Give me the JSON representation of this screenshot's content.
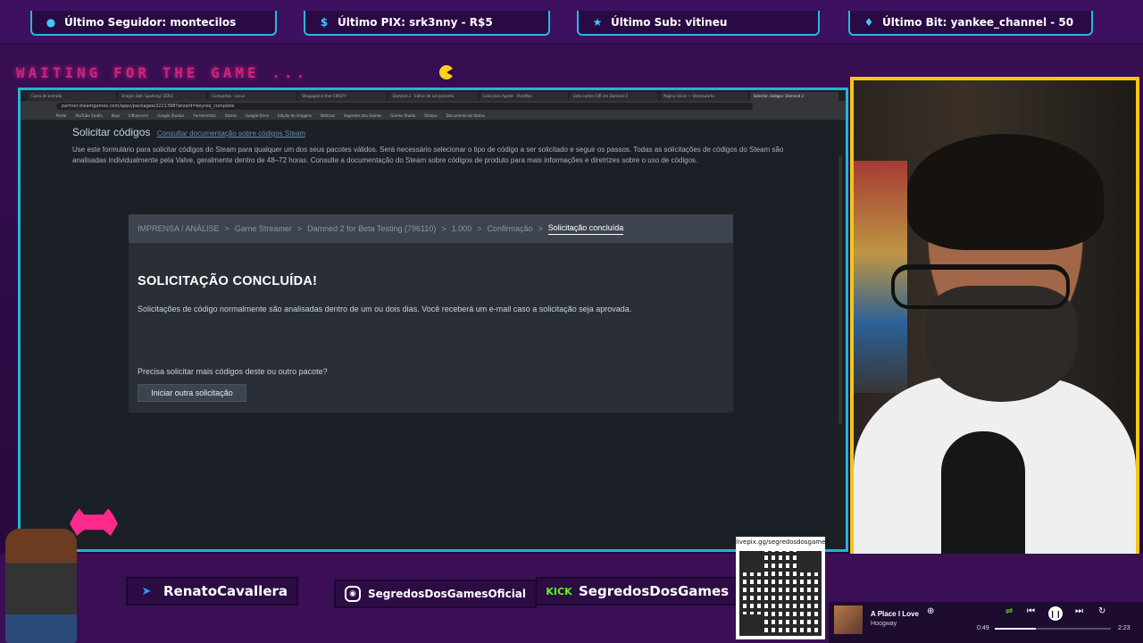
{
  "alerts": [
    {
      "icon": "user-icon",
      "label": "Último Seguidor: montecilos"
    },
    {
      "icon": "dollar-icon",
      "label": "Último PIX: srk3nny - R$5"
    },
    {
      "icon": "star-icon",
      "label": "Último Sub: vitineu"
    },
    {
      "icon": "diamond-icon",
      "label": "Último Bit: yankee_channel - 50"
    }
  ],
  "brand": {
    "waiting": "WAITING FOR THE GAME ..."
  },
  "browser": {
    "tabs": [
      "Caixa de entrada",
      "Dragon Ball: Sparking! ZERO",
      "Compartes - arcvo",
      "Shoppgame that CRAZY!",
      "Damned 2 - Editor de Lançamento",
      "Colecções Applet - PlanMax",
      "Lista contos CJR em Damned 2",
      "Página inicial — Steamworks",
      "Solicitar códigos: Damned 2"
    ],
    "url": "partner.steamgames.com/apps/packages/2221398?wizard=keyreq_complete",
    "bookmarks": [
      "Portal",
      "YouTube Studio",
      "Keys",
      "Influencers",
      "Google Studios",
      "Ferramentas",
      "Outros",
      "Google Drive",
      "Edição de imagens",
      "Notícias",
      "Segredos dos Games",
      "Games Studio",
      "Stratus",
      "Documento de Status"
    ]
  },
  "steam": {
    "page_title": "Solicitar códigos",
    "page_title_link": "Consultar documentação sobre códigos Steam",
    "description": "Use este formulário para solicitar códigos do Steam para qualquer um dos seus pacotes válidos. Será necessário selecionar o tipo de código a ser solicitado e seguir os passos. Todas as solicitações de códigos do Steam são analisadas individualmente pela Valve, geralmente dentro de 48–72 horas. Consulte a documentação do Steam sobre códigos de produto para mais informações e diretrizes sobre o uso de códigos.",
    "breadcrumbs": [
      "IMPRENSA / ANÁLISE",
      "Game Streamer",
      "Damned 2 for Beta Testing (796110)",
      "1.000",
      "Confirmação",
      "Solicitação concluída"
    ],
    "heading": "SOLICITAÇÃO CONCLUÍDA!",
    "message": "Solicitações de código normalmente são analisadas dentro de um ou dois dias. Você receberá um e-mail caso a solicitação seja aprovada.",
    "question": "Precisa solicitar mais códigos deste ou outro pacote?",
    "button": "Iniciar outra solicitação"
  },
  "socials": {
    "twitter": "RenatoCavallera",
    "instagram": "SegredosDosGamesOficial",
    "kick_logo": "KICK",
    "kick": "SegredosDosGames"
  },
  "qr": {
    "url": "livepix.gg/segredosdosgames"
  },
  "player": {
    "song": "A Place I Love",
    "artist": "Hoogway",
    "elapsed": "0:49",
    "total": "2:23",
    "progress": 0.35
  },
  "colors": {
    "accent": "#1fb6d8",
    "cam_border": "#f5c518",
    "brand_pink": "#ff2a8c"
  }
}
